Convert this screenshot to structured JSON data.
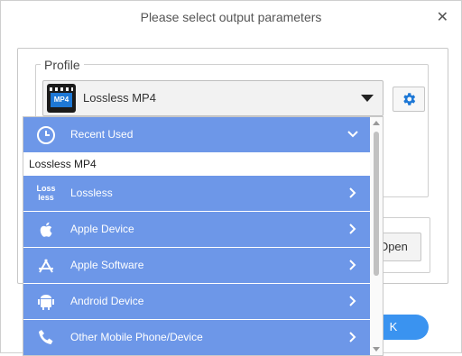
{
  "dialog": {
    "title": "Please select output parameters",
    "close_glyph": "✕"
  },
  "profile": {
    "legend": "Profile",
    "selected": "Lossless MP4",
    "logo_text": "MP4"
  },
  "buttons": {
    "open": "Open",
    "ok": "K"
  },
  "dropdown": {
    "recent_header": "Recent Used",
    "recent_items": [
      "Lossless MP4"
    ],
    "categories": [
      {
        "label": "Lossless",
        "icon": "lossless-icon",
        "icon_text": "Loss less"
      },
      {
        "label": "Apple Device",
        "icon": "apple-icon"
      },
      {
        "label": "Apple Software",
        "icon": "app-store-icon"
      },
      {
        "label": "Android Device",
        "icon": "android-icon"
      },
      {
        "label": "Other Mobile Phone/Device",
        "icon": "phone-icon"
      }
    ]
  },
  "colors": {
    "row_bg": "#6d97e8",
    "ok_bg": "#3a93f0",
    "gear": "#1e78d6"
  }
}
